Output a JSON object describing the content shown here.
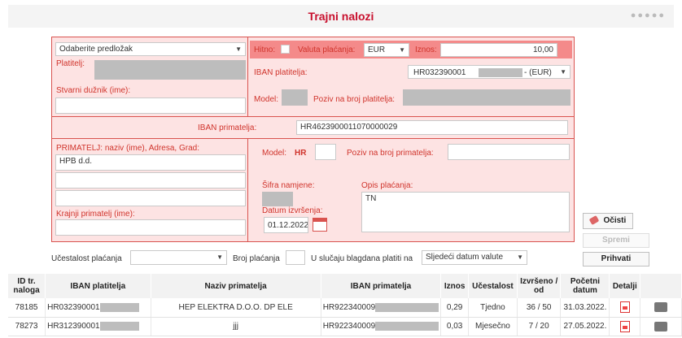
{
  "title": "Trajni nalozi",
  "form": {
    "template_select": "Odaberite predložak",
    "platitelj_label": "Platitelj:",
    "stvarni_duznik_label": "Stvarni dužnik (ime):",
    "hitno_label": "Hitno:",
    "valuta_label": "Valuta plaćanja:",
    "valuta_value": "EUR",
    "iznos_label": "Iznos:",
    "iznos_value": "10,00",
    "iban_platitelja_label": "IBAN platitelja:",
    "iban_platitelja_prefix": "HR032390001",
    "iban_platitelja_suffix": "- (EUR)",
    "model_label": "Model:",
    "poziv_platitelja_label": "Poziv na broj platitelja:",
    "iban_primatelja_label": "IBAN primatelja:",
    "iban_primatelja_value": "HR4623900011070000029",
    "primatelj_label": "PRIMATELJ: naziv (ime), Adresa, Grad:",
    "primatelj_line1": "HPB d.d.",
    "primatelj_line2": "",
    "primatelj_line3": "",
    "krajnji_primatelj_label": "Krajnji primatelj (ime):",
    "model2_label": "Model:",
    "model2_hr": "HR",
    "poziv_primatelja_label": "Poziv na broj primatelja:",
    "sifra_namjene_label": "Šifra namjene:",
    "opis_placanja_label": "Opis plaćanja:",
    "opis_placanja_value": "TN",
    "datum_izvrsenja_label": "Datum izvršenja:",
    "datum_izvrsenja_value": "01.12.2022."
  },
  "buttons": {
    "ocisti": "Očisti",
    "spremi": "Spremi",
    "prihvati": "Prihvati"
  },
  "options_row": {
    "ucestalost_label": "Učestalost plaćanja",
    "broj_placanja_label": "Broj plaćanja",
    "blagdan_label": "U slučaju blagdana platiti na",
    "blagdan_value": "Sljedeći datum valute"
  },
  "table": {
    "headers": [
      "ID tr. naloga",
      "IBAN platitelja",
      "Naziv primatelja",
      "IBAN primatelja",
      "Iznos",
      "Učestalost",
      "Izvršeno / od",
      "Početni datum",
      "Detalji"
    ],
    "rows": [
      {
        "id": "78185",
        "iban_pl": "HR032390001",
        "naziv": "HEP ELEKTRA D.O.O. DP ELE",
        "iban_pr": "HR922340009",
        "iznos": "0,29",
        "ucestalost": "Tjedno",
        "izvrseno": "36 / 50",
        "datum": "31.03.2022."
      },
      {
        "id": "78273",
        "iban_pl": "HR312390001",
        "naziv": "jjj",
        "iban_pr": "HR922340009",
        "iznos": "0,03",
        "ucestalost": "Mjesečno",
        "izvrseno": "7 / 20",
        "datum": "27.05.2022."
      }
    ]
  },
  "colors": {
    "accent": "#c8102e",
    "panel_bg": "#fde3e3",
    "panel_border": "#d9534f"
  }
}
